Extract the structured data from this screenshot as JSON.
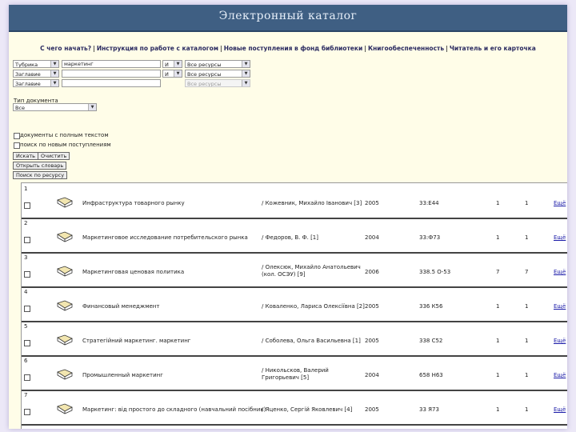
{
  "header": {
    "title": "Электронный каталог"
  },
  "nav": {
    "links": [
      "С чего начать?",
      "Инструкция по работе с каталогом",
      "Новые поступления в фонд библиотеки",
      "Книгообеспеченность",
      "Читатель и его карточка"
    ]
  },
  "search": {
    "rows": [
      {
        "field": "Тубрика",
        "value": "маркетинг",
        "op": "И",
        "scope": "Все ресурсы",
        "scope_disabled": false
      },
      {
        "field": "Заглавие",
        "value": "",
        "op": "И",
        "scope": "Все ресурсы",
        "scope_disabled": false
      },
      {
        "field": "Заглавие",
        "value": "",
        "op": "",
        "scope": "Все ресурсы",
        "scope_disabled": true
      }
    ],
    "doc_type_label": "Тип документа",
    "doc_type_value": "Все",
    "check_fulltext": "документы с полным текстом",
    "check_new": "поиск по новым поступлениям",
    "search_button": "Искать",
    "clear_button": "Очистить",
    "dictionary_button": "Открыть словарь",
    "resource_button": "Поиск по ресурсу"
  },
  "results": {
    "more_label": "Ещё",
    "records": [
      {
        "num": "1",
        "title": "Инфраструктура товарного рынку",
        "author": "/ Кожевник, Михайло Іванович [3]",
        "year": "2005",
        "shelf": "33:Е44",
        "c1": "1",
        "c2": "1"
      },
      {
        "num": "2",
        "title": "Маркетинговое исследование потребительского рынка",
        "author": "/ Федоров, В. Ф. [1]",
        "year": "2004",
        "shelf": "33:Ф73",
        "c1": "1",
        "c2": "1"
      },
      {
        "num": "3",
        "title": "Маркетинговая ценовая политика",
        "author": "/ Олексюк, Михайло Анатольевич (кол. ОСЭУ) [9]",
        "year": "2006",
        "shelf": "338.5 О-53",
        "c1": "7",
        "c2": "7"
      },
      {
        "num": "4",
        "title": "Финансовый менеджмент",
        "author": "/ Коваленко, Лариса Олексіївна [2]",
        "year": "2005",
        "shelf": "336 К56",
        "c1": "1",
        "c2": "1"
      },
      {
        "num": "5",
        "title": "Стратегійний маркетинг. маркетинг",
        "author": "/ Соболева, Ольга Васильевна [1]",
        "year": "2005",
        "shelf": "338 С52",
        "c1": "1",
        "c2": "1"
      },
      {
        "num": "6",
        "title": "Промышленный маркетинг",
        "author": "/ Никольсков, Валерий Григорьевич [5]",
        "year": "2004",
        "shelf": "658 Н63",
        "c1": "1",
        "c2": "1"
      },
      {
        "num": "7",
        "title": "Маркетинг: від простого до складного (навчальний посібник)",
        "author": "/ Яценко, Сергій Яковлевич [4]",
        "year": "2005",
        "shelf": "33 Я73",
        "c1": "1",
        "c2": "1"
      }
    ]
  }
}
